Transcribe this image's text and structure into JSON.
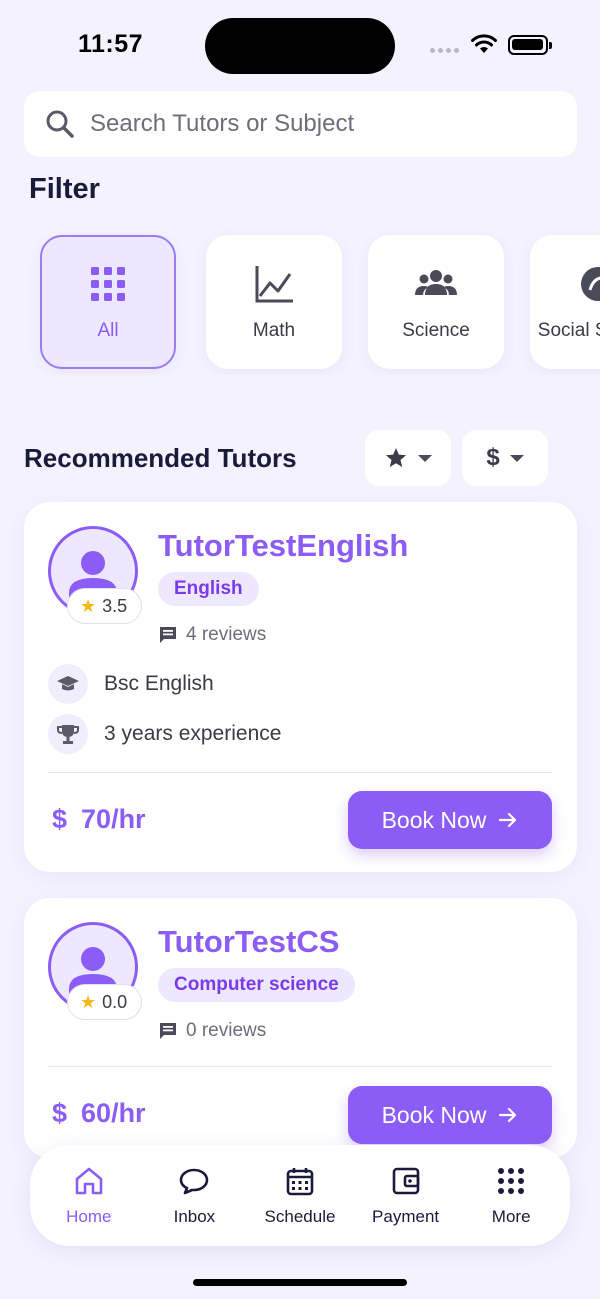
{
  "status_bar": {
    "time": "11:57"
  },
  "search": {
    "placeholder": "Search Tutors or Subject"
  },
  "filter": {
    "title": "Filter",
    "chips": [
      {
        "label": "All",
        "icon": "grid-icon",
        "active": true
      },
      {
        "label": "Math",
        "icon": "chart-line-icon",
        "active": false
      },
      {
        "label": "Science",
        "icon": "group-icon",
        "active": false
      },
      {
        "label": "Social Studies",
        "icon": "globe-icon",
        "active": false
      }
    ]
  },
  "recommended": {
    "title": "Recommended Tutors",
    "sort_rating_icon": "star-icon",
    "sort_price_icon": "dollar-icon",
    "sort_price_glyph": "$"
  },
  "tutors": [
    {
      "name": "TutorTestEnglish",
      "rating": "3.5",
      "subject": "English",
      "reviews": "4 reviews",
      "degree": "Bsc English",
      "experience": "3 years experience",
      "price": "70/hr",
      "currency": "$",
      "book_label": "Book Now"
    },
    {
      "name": "TutorTestCS",
      "rating": "0.0",
      "subject": "Computer science",
      "reviews": "0 reviews",
      "price": "60/hr",
      "currency": "$",
      "book_label": "Book Now"
    }
  ],
  "nav": {
    "items": [
      {
        "label": "Home",
        "icon": "home-icon",
        "active": true
      },
      {
        "label": "Inbox",
        "icon": "chat-bubble-icon"
      },
      {
        "label": "Schedule",
        "icon": "calendar-icon"
      },
      {
        "label": "Payment",
        "icon": "wallet-icon"
      },
      {
        "label": "More",
        "icon": "dots-grid-icon"
      }
    ]
  },
  "colors": {
    "accent": "#8b5cf6",
    "background": "#f4f2fe",
    "text": "#1c1a3a",
    "star": "#f5b914"
  }
}
